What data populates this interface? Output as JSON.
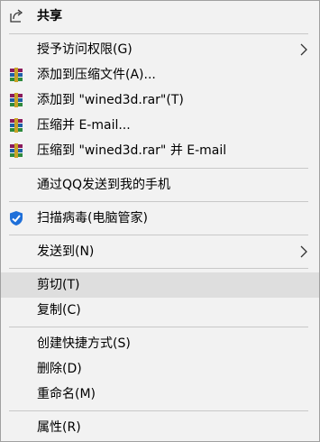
{
  "menu": {
    "share": "共享",
    "grant_access": "授予访问权限(G)",
    "add_to_archive": "添加到压缩文件(A)...",
    "add_to_rar": "添加到 \"wined3d.rar\"(T)",
    "compress_email": "压缩并 E-mail...",
    "compress_rar_email": "压缩到 \"wined3d.rar\" 并 E-mail",
    "send_via_qq": "通过QQ发送到我的手机",
    "scan_virus": "扫描病毒(电脑管家)",
    "send_to": "发送到(N)",
    "cut": "剪切(T)",
    "copy": "复制(C)",
    "create_shortcut": "创建快捷方式(S)",
    "delete": "删除(D)",
    "rename": "重命名(M)",
    "properties": "属性(R)"
  },
  "icons": {
    "share": "share-icon",
    "winrar": "winrar-icon",
    "tencent": "tencent-pc-manager-icon",
    "submenu": "chevron-right-icon"
  },
  "colors": {
    "background": "#f2f2f2",
    "highlight": "#dedede",
    "separator": "#c8c8c8",
    "tencent_blue": "#1e6fd9"
  }
}
